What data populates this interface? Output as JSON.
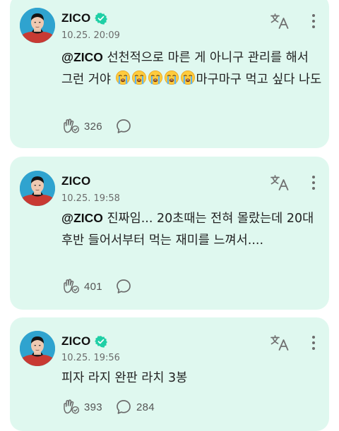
{
  "posts": [
    {
      "author": "ZICO",
      "verified": true,
      "time": "10.25. 20:09",
      "mention": "@ZICO",
      "text_before_emoji": " 선천적으로 마른 게 아니구 관리를 해서 그런 거야 ",
      "emoji_count": 5,
      "emoji_icon": "loudly-crying-face",
      "text_after_emoji": "마구마구 먹고 싶다 나도",
      "reactions": "326",
      "comments": ""
    },
    {
      "author": "ZICO",
      "verified": false,
      "time": "10.25. 19:58",
      "mention": "@ZICO",
      "text": " 진짜임... 20초때는 전혀 몰랐는데 20대 후반 들어서부터 먹는 재미를 느껴서....",
      "reactions": "401",
      "comments": ""
    },
    {
      "author": "ZICO",
      "verified": true,
      "time": "10.25. 19:56",
      "text": "피자 라지 완판 라치 3봉",
      "reactions": "393",
      "comments": "284"
    }
  ],
  "icons": {
    "translate": "translate-icon",
    "more": "more-vertical-icon",
    "reaction": "reaction-hand-icon",
    "comment": "comment-bubble-icon",
    "verified": "verified-badge-icon"
  },
  "colors": {
    "card_background": "#dff8ef",
    "verified": "#1fcfa5",
    "icon": "#6c6c6c"
  }
}
